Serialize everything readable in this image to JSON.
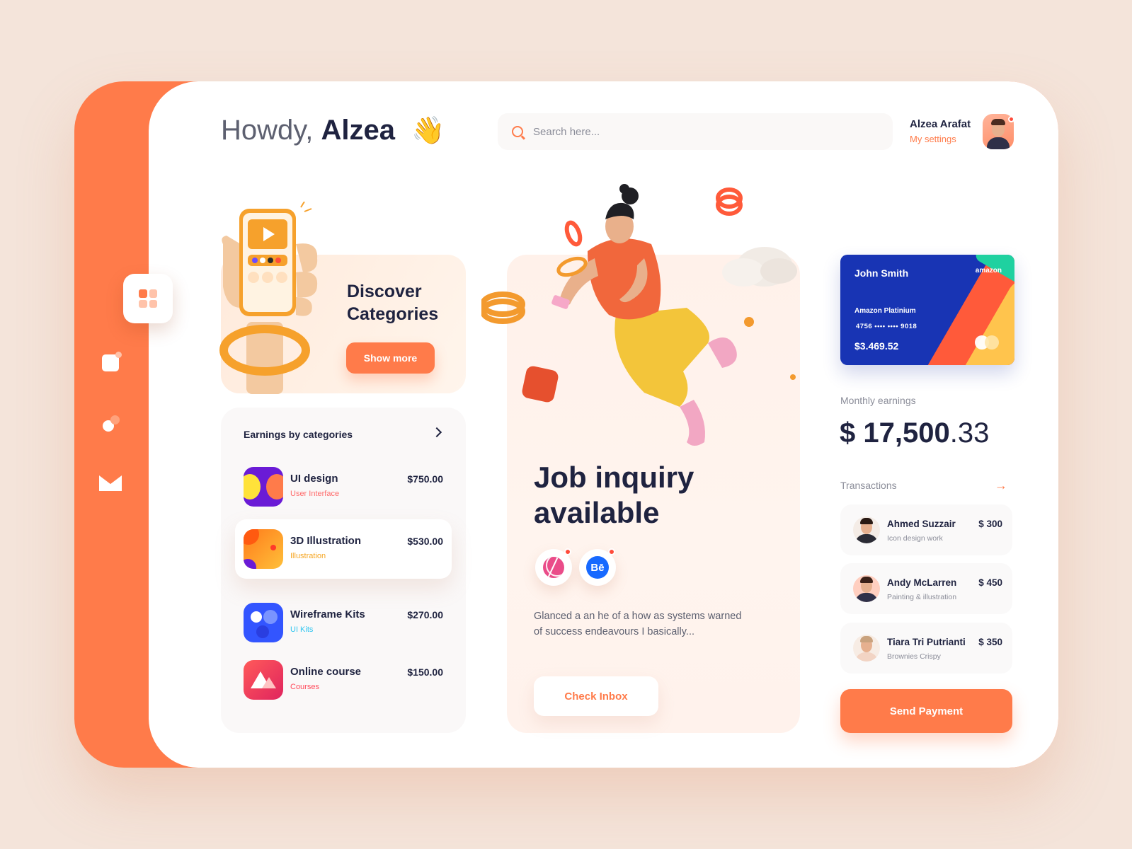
{
  "header": {
    "greeting_prefix": "Howdy,",
    "greeting_name": "Alzea",
    "wave_emoji": "👋",
    "search_placeholder": "Search here...",
    "user_name": "Alzea Arafat",
    "user_settings": "My settings"
  },
  "sidebar": {
    "items": [
      {
        "name": "dashboard",
        "icon": "grid-icon",
        "active": true
      },
      {
        "name": "documents",
        "icon": "document-icon",
        "active": false
      },
      {
        "name": "activity",
        "icon": "circles-icon",
        "active": false
      },
      {
        "name": "mail",
        "icon": "mail-icon",
        "active": false
      }
    ]
  },
  "discover": {
    "title": "Discover Categories",
    "button": "Show more"
  },
  "earnings": {
    "title": "Earnings by categories",
    "items": [
      {
        "name": "UI design",
        "sub": "User Interface",
        "amount": "$750.00",
        "sub_color": "#ff6a6a"
      },
      {
        "name": "3D Illustration",
        "sub": "Illustration",
        "amount": "$530.00",
        "sub_color": "#f6a623"
      },
      {
        "name": "Wireframe Kits",
        "sub": "UI Kits",
        "amount": "$270.00",
        "sub_color": "#2ec5f0"
      },
      {
        "name": "Online course",
        "sub": "Courses",
        "amount": "$150.00",
        "sub_color": "#ff4b5c"
      }
    ]
  },
  "job": {
    "title": "Job inquiry available",
    "description": "Glanced a an he of a how as systems warned of success endeavours I basically...",
    "button": "Check Inbox",
    "behance_label": "Bē"
  },
  "card": {
    "holder": "John Smith",
    "brand": "amazon",
    "type": "Amazon Platinium",
    "number": "4756  ••••  ••••  9018",
    "balance": "$3.469.52"
  },
  "monthly": {
    "label": "Monthly earnings",
    "currency": "$",
    "whole": "17,500",
    "decimal": ".33"
  },
  "transactions": {
    "label": "Transactions",
    "arrow": "→",
    "items": [
      {
        "name": "Ahmed Suzzair",
        "sub": "Icon design work",
        "amount": "$ 300"
      },
      {
        "name": "Andy McLarren",
        "sub": "Painting & illustration",
        "amount": "$ 450"
      },
      {
        "name": "Tiara Tri Putrianti",
        "sub": "Brownies Crispy",
        "amount": "$ 350"
      }
    ],
    "button": "Send Payment"
  },
  "colors": {
    "accent": "#ff7b4a",
    "dark": "#1f2340",
    "card_blue": "#1834b4"
  }
}
